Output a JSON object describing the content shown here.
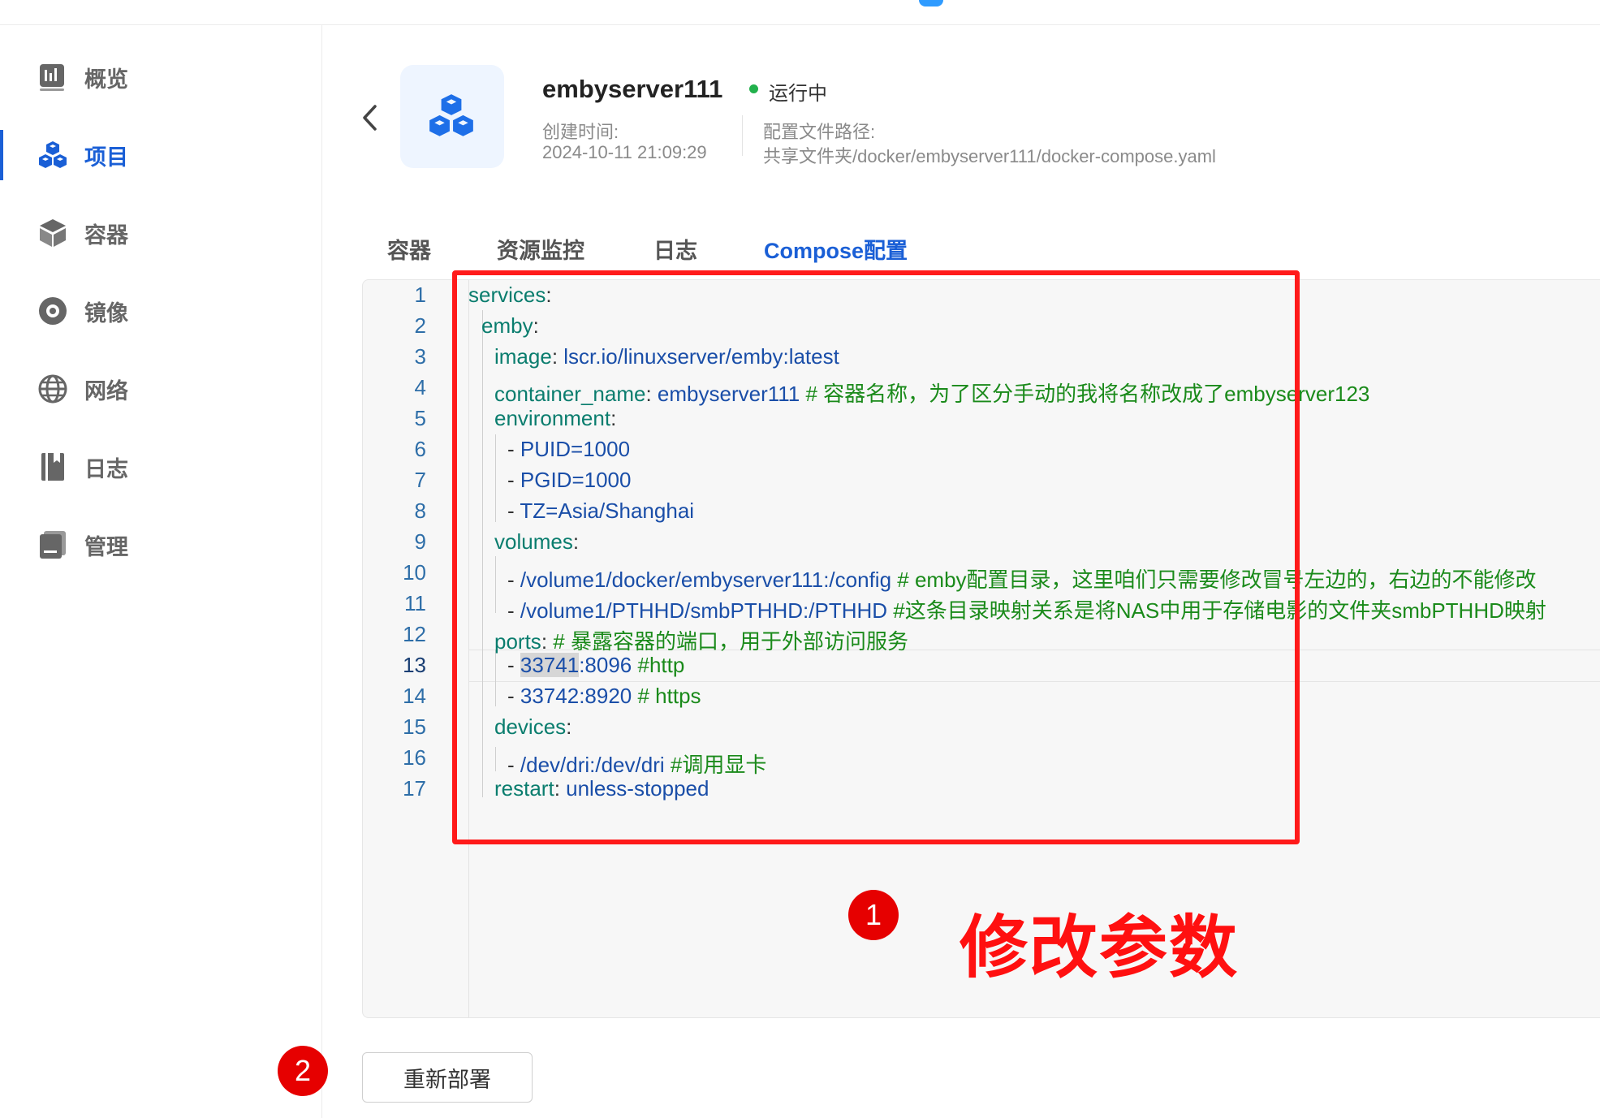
{
  "sidebar": {
    "items": [
      {
        "label": "概览",
        "icon": "dashboard-icon"
      },
      {
        "label": "项目",
        "icon": "cubes-icon",
        "active": true
      },
      {
        "label": "容器",
        "icon": "container-icon"
      },
      {
        "label": "镜像",
        "icon": "disc-icon"
      },
      {
        "label": "网络",
        "icon": "globe-icon"
      },
      {
        "label": "日志",
        "icon": "book-icon"
      },
      {
        "label": "管理",
        "icon": "manage-icon"
      }
    ]
  },
  "project": {
    "name": "embyserver111",
    "status": "运行中",
    "created_label": "创建时间:",
    "created_value": "2024-10-11 21:09:29",
    "config_label": "配置文件路径:",
    "config_value": "共享文件夹/docker/embyserver111/docker-compose.yaml"
  },
  "tabs": [
    "容器",
    "资源监控",
    "日志",
    "Compose配置"
  ],
  "active_tab": "Compose配置",
  "editor": {
    "line_numbers": [
      "1",
      "2",
      "3",
      "4",
      "5",
      "6",
      "7",
      "8",
      "9",
      "10",
      "11",
      "12",
      "13",
      "14",
      "15",
      "16",
      "17"
    ],
    "current_line": 13,
    "lines": [
      {
        "key": "services",
        "sep": ":",
        "value": "",
        "comment": ""
      },
      {
        "key": "emby",
        "sep": ":",
        "value": "",
        "comment": ""
      },
      {
        "key": "image",
        "sep": ": ",
        "value": "lscr.io/linuxserver/emby:latest",
        "comment": ""
      },
      {
        "key": "container_name",
        "sep": ": ",
        "value": "embyserver111",
        "comment": " # 容器名称，为了区分手动的我将名称改成了embyserver123"
      },
      {
        "key": "environment",
        "sep": ":",
        "value": "",
        "comment": ""
      },
      {
        "key": "- ",
        "sep": "",
        "value": "PUID=1000",
        "comment": ""
      },
      {
        "key": "- ",
        "sep": "",
        "value": "PGID=1000",
        "comment": ""
      },
      {
        "key": "- ",
        "sep": "",
        "value": "TZ=Asia/Shanghai",
        "comment": ""
      },
      {
        "key": "volumes",
        "sep": ":",
        "value": "",
        "comment": ""
      },
      {
        "key": "- ",
        "sep": "",
        "value": "/volume1/docker/embyserver111:/config",
        "comment": "  # emby配置目录，这里咱们只需要修改冒号左边的，右边的不能修改"
      },
      {
        "key": "- ",
        "sep": "",
        "value": "/volume1/PTHHD/smbPTHHD:/PTHHD",
        "comment": "    #这条目录映射关系是将NAS中用于存储电影的文件夹smbPTHHD映射"
      },
      {
        "key": "ports",
        "sep": ": ",
        "value": "",
        "comment": "# 暴露容器的端口，用于外部访问服务"
      },
      {
        "key": "- ",
        "sep": "",
        "value_hl": "33741",
        "value": ":8096",
        "comment": " #http"
      },
      {
        "key": "- ",
        "sep": "",
        "value": "33742:8920",
        "comment": " # https"
      },
      {
        "key": "devices",
        "sep": ":",
        "value": "",
        "comment": ""
      },
      {
        "key": "- ",
        "sep": "",
        "value": "/dev/dri:/dev/dri",
        "comment": " #调用显卡"
      },
      {
        "key": "restart",
        "sep": ": ",
        "value": "unless-stopped",
        "comment": ""
      }
    ]
  },
  "annotations": {
    "badge1": "1",
    "badge2": "2",
    "text": "修改参数"
  },
  "actions": {
    "redeploy_label": "重新部署"
  },
  "colors": {
    "accent": "#1a5fd6",
    "status_green": "#22b14c",
    "annotation_red": "#ff1a1a",
    "yaml_key": "#0a7d6e",
    "yaml_value": "#1a4ea8",
    "yaml_comment": "#1a8a1a"
  }
}
